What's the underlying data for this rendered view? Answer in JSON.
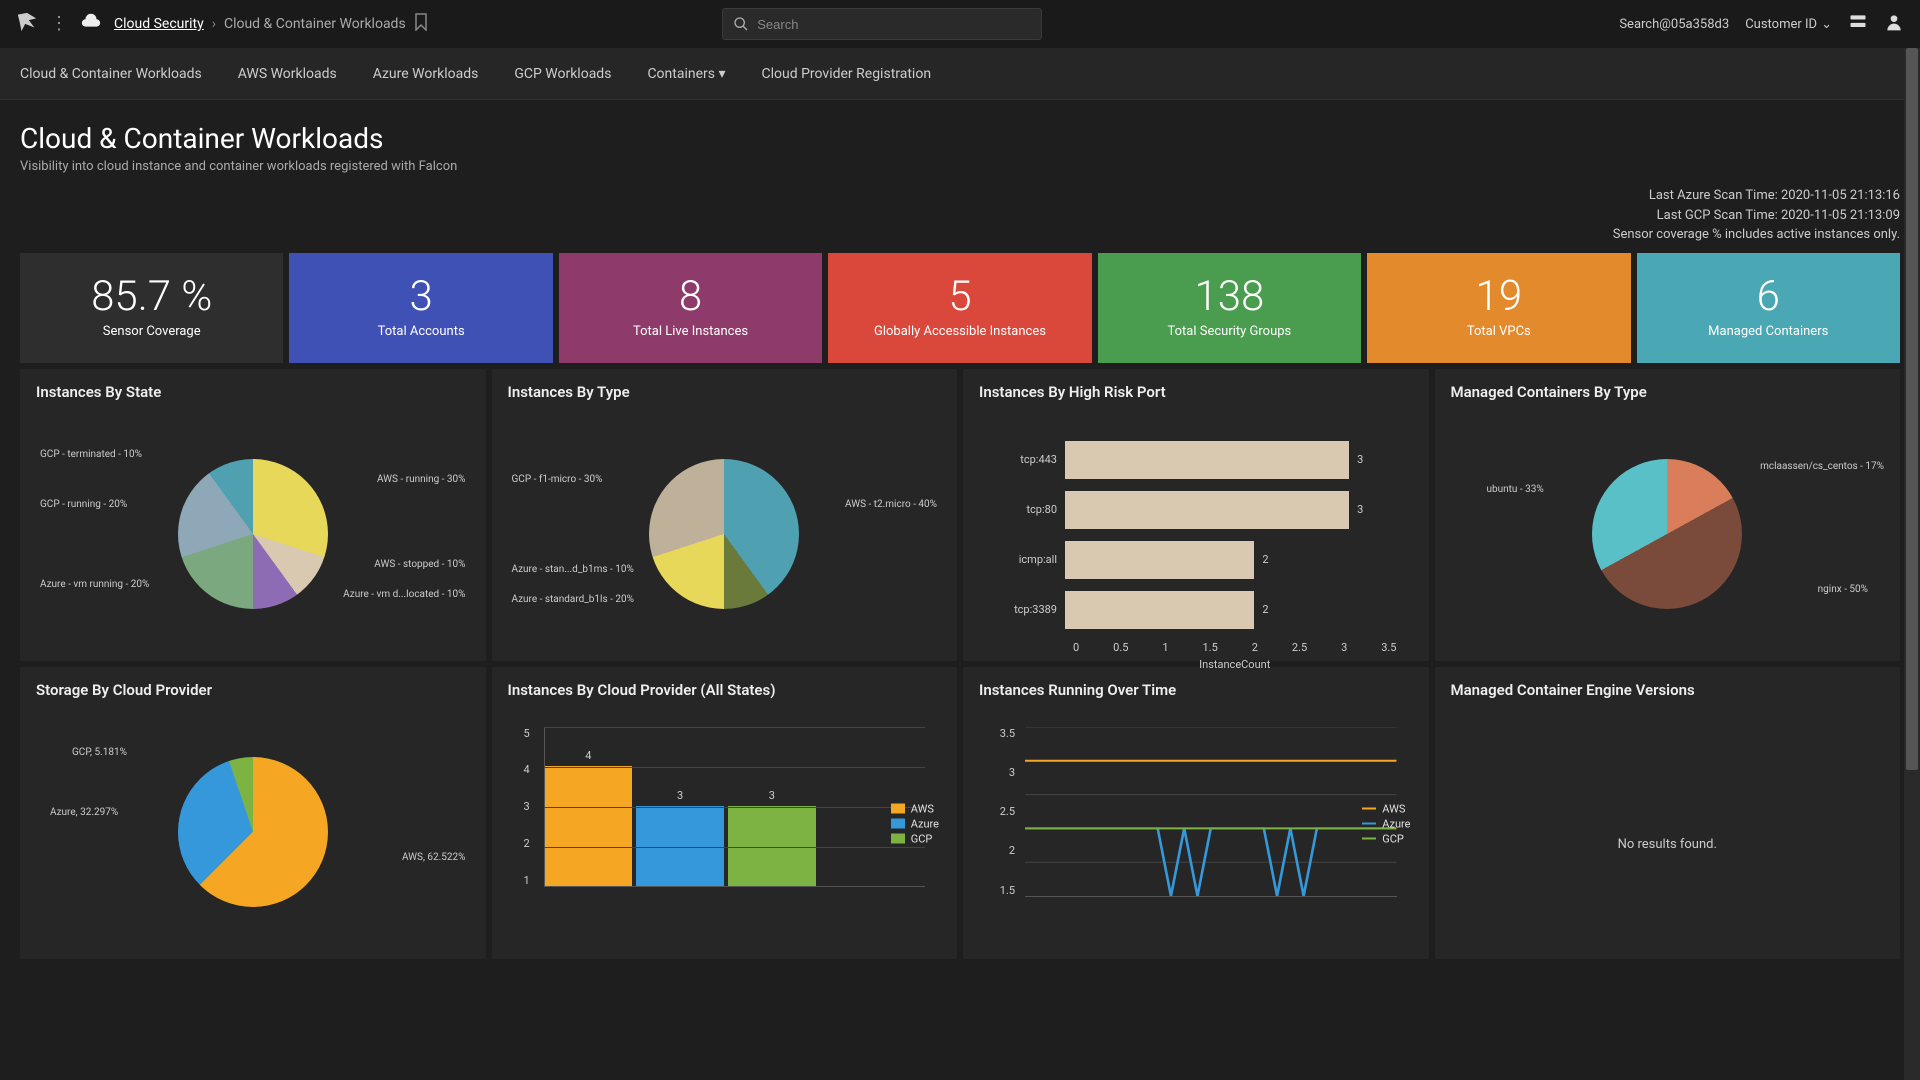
{
  "topbar": {
    "breadcrumb_main": "Cloud Security",
    "breadcrumb_sub": "Cloud & Container Workloads",
    "search_placeholder": "Search",
    "search_id": "Search@05a358d3",
    "customer_label": "Customer ID"
  },
  "nav": {
    "items": [
      "Cloud & Container Workloads",
      "AWS Workloads",
      "Azure Workloads",
      "GCP Workloads",
      "Containers",
      "Cloud Provider Registration"
    ]
  },
  "header": {
    "title": "Cloud & Container Workloads",
    "subtitle": "Visibility into cloud instance and container workloads registered with Falcon"
  },
  "scan_info": {
    "line1": "Last Azure Scan Time: 2020-11-05 21:13:16",
    "line2": "Last GCP Scan Time: 2020-11-05 21:13:09",
    "line3": "Sensor coverage % includes active instances only."
  },
  "kpis": [
    {
      "value": "85.7 %",
      "label": "Sensor Coverage",
      "color": "#2e2e2e"
    },
    {
      "value": "3",
      "label": "Total Accounts",
      "color": "#3f51b5"
    },
    {
      "value": "8",
      "label": "Total Live Instances",
      "color": "#8e3a6a"
    },
    {
      "value": "5",
      "label": "Globally Accessible Instances",
      "color": "#d9483b"
    },
    {
      "value": "138",
      "label": "Total Security Groups",
      "color": "#4a9d4f"
    },
    {
      "value": "19",
      "label": "Total VPCs",
      "color": "#e38a2c"
    },
    {
      "value": "6",
      "label": "Managed Containers",
      "color": "#4aa8b5"
    }
  ],
  "panels": {
    "row1": [
      {
        "title": "Instances By State"
      },
      {
        "title": "Instances By Type"
      },
      {
        "title": "Instances By High Risk Port"
      },
      {
        "title": "Managed Containers By Type"
      }
    ],
    "row2": [
      {
        "title": "Storage By Cloud Provider"
      },
      {
        "title": "Instances By Cloud Provider (All States)"
      },
      {
        "title": "Instances Running Over Time"
      },
      {
        "title": "Managed Container Engine Versions"
      }
    ]
  },
  "no_results": "No results found.",
  "legends": {
    "providers": [
      "AWS",
      "Azure",
      "GCP"
    ]
  },
  "colors": {
    "aws": "#f5a623",
    "azure": "#3498db",
    "gcp": "#7cb342",
    "bar_beige": "#d8c9b0"
  },
  "chart_data": [
    {
      "id": "instances_by_state",
      "type": "pie",
      "title": "Instances By State",
      "slices": [
        {
          "label": "AWS - running - 30%",
          "value": 30,
          "color": "#e8d85a"
        },
        {
          "label": "AWS - stopped - 10%",
          "value": 10,
          "color": "#d8c9b0"
        },
        {
          "label": "Azure - vm d...located - 10%",
          "value": 10,
          "color": "#8e6bb5"
        },
        {
          "label": "Azure - vm running - 20%",
          "value": 20,
          "color": "#7ba87f"
        },
        {
          "label": "GCP - running - 20%",
          "value": 20,
          "color": "#8fa8b8"
        },
        {
          "label": "GCP - terminated - 10%",
          "value": 10,
          "color": "#4fa0b0"
        }
      ]
    },
    {
      "id": "instances_by_type",
      "type": "pie",
      "title": "Instances By Type",
      "slices": [
        {
          "label": "AWS - t2.micro - 40%",
          "value": 40,
          "color": "#4fa0b0"
        },
        {
          "label": "Azure - stan...d_b1ms - 10%",
          "value": 10,
          "color": "#6a7a3a"
        },
        {
          "label": "Azure - standard_b1ls - 20%",
          "value": 20,
          "color": "#e8d85a"
        },
        {
          "label": "GCP - f1-micro - 30%",
          "value": 30,
          "color": "#bfb09a"
        }
      ]
    },
    {
      "id": "instances_by_high_risk_port",
      "type": "bar",
      "title": "Instances By High Risk Port",
      "orientation": "horizontal",
      "categories": [
        "tcp:443",
        "tcp:80",
        "icmp:all",
        "tcp:3389"
      ],
      "values": [
        3,
        3,
        2,
        2
      ],
      "xlabel": "InstanceCount",
      "xlim": [
        0,
        3.5
      ],
      "xticks": [
        0,
        0.5,
        1,
        1.5,
        2,
        2.5,
        3,
        3.5
      ]
    },
    {
      "id": "managed_containers_by_type",
      "type": "pie",
      "title": "Managed Containers By Type",
      "slices": [
        {
          "label": "mclaassen/cs_centos - 17%",
          "value": 17,
          "color": "#d97d5a"
        },
        {
          "label": "nginx - 50%",
          "value": 50,
          "color": "#7a4a3a"
        },
        {
          "label": "ubuntu - 33%",
          "value": 33,
          "color": "#5ac0c8"
        }
      ]
    },
    {
      "id": "storage_by_cloud_provider",
      "type": "pie",
      "title": "Storage By Cloud Provider",
      "slices": [
        {
          "label": "AWS, 62.522%",
          "value": 62.522,
          "color": "#f5a623"
        },
        {
          "label": "Azure, 32.297%",
          "value": 32.297,
          "color": "#3498db"
        },
        {
          "label": "GCP, 5.181%",
          "value": 5.181,
          "color": "#7cb342"
        }
      ]
    },
    {
      "id": "instances_by_cloud_provider_all_states",
      "type": "bar",
      "title": "Instances By Cloud Provider (All States)",
      "orientation": "vertical",
      "series": [
        {
          "name": "AWS",
          "values": [
            4
          ],
          "color": "#f5a623"
        },
        {
          "name": "Azure",
          "values": [
            3
          ],
          "color": "#3498db"
        },
        {
          "name": "GCP",
          "values": [
            3
          ],
          "color": "#7cb342"
        }
      ],
      "ylim": [
        1,
        5
      ],
      "yticks": [
        1,
        2,
        3,
        4,
        5
      ]
    },
    {
      "id": "instances_running_over_time",
      "type": "line",
      "title": "Instances Running Over Time",
      "x": [
        0,
        1,
        2,
        3,
        4,
        5,
        6,
        7,
        8,
        9,
        10,
        11,
        12,
        13,
        14,
        15,
        16,
        17,
        18,
        19,
        20,
        21,
        22,
        23,
        24,
        25,
        26,
        27,
        28
      ],
      "series": [
        {
          "name": "AWS",
          "color": "#f5a623",
          "values": [
            3,
            3,
            3,
            3,
            3,
            3,
            3,
            3,
            3,
            3,
            3,
            3,
            3,
            3,
            3,
            3,
            3,
            3,
            3,
            3,
            3,
            3,
            3,
            3,
            3,
            3,
            3,
            3,
            3
          ]
        },
        {
          "name": "Azure",
          "color": "#3498db",
          "values": [
            2,
            2,
            2,
            2,
            2,
            2,
            2,
            2,
            2,
            2,
            2,
            1,
            2,
            1,
            2,
            2,
            2,
            2,
            2,
            1,
            2,
            1,
            2,
            2,
            2,
            2,
            2,
            2,
            2
          ]
        },
        {
          "name": "GCP",
          "color": "#7cb342",
          "values": [
            2,
            2,
            2,
            2,
            2,
            2,
            2,
            2,
            2,
            2,
            2,
            2,
            2,
            2,
            2,
            2,
            2,
            2,
            2,
            2,
            2,
            2,
            2,
            2,
            2,
            2,
            2,
            2,
            2
          ]
        }
      ],
      "ylim": [
        1,
        3.5
      ],
      "yticks": [
        1.5,
        2,
        2.5,
        3,
        3.5
      ]
    },
    {
      "id": "managed_container_engine_versions",
      "type": "table",
      "title": "Managed Container Engine Versions",
      "empty_message": "No results found."
    }
  ]
}
